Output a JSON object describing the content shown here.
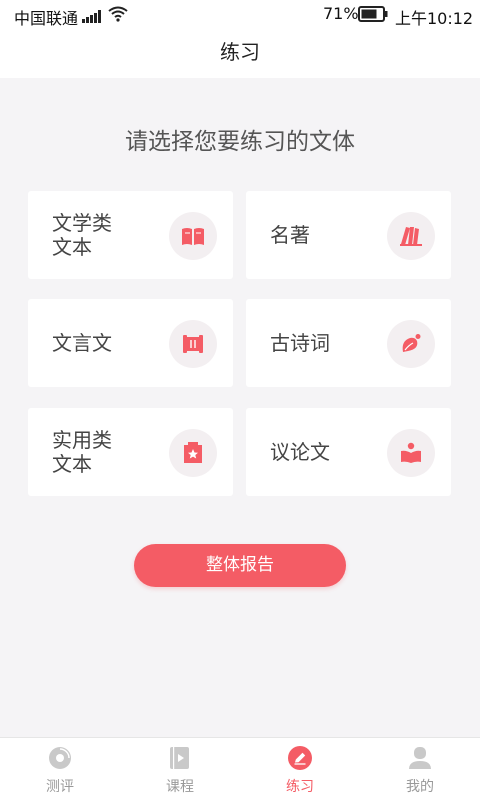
{
  "status_bar": {
    "carrier": "中国联通",
    "battery": "71%",
    "time": "上午10:12"
  },
  "header": {
    "title": "练习"
  },
  "prompt": "请选择您要练习的文体",
  "genres": [
    {
      "label": "文学类\n文本",
      "icon": "open-book-icon"
    },
    {
      "label": "名著",
      "icon": "stacked-books-icon"
    },
    {
      "label": "文言文",
      "icon": "scroll-icon"
    },
    {
      "label": "古诗词",
      "icon": "leaf-icon"
    },
    {
      "label": "实用类\n文本",
      "icon": "star-folder-icon"
    },
    {
      "label": "议论文",
      "icon": "reader-icon"
    }
  ],
  "report_button": "整体报告",
  "tabs": [
    {
      "label": "测评",
      "icon": "disc-icon",
      "active": false
    },
    {
      "label": "课程",
      "icon": "video-book-icon",
      "active": false
    },
    {
      "label": "练习",
      "icon": "pencil-circle-icon",
      "active": true
    },
    {
      "label": "我的",
      "icon": "user-icon",
      "active": false
    }
  ],
  "colors": {
    "accent": "#f45c65",
    "background": "#f5f4f6",
    "icon_bg": "#f3eff1",
    "inactive": "#999999"
  }
}
